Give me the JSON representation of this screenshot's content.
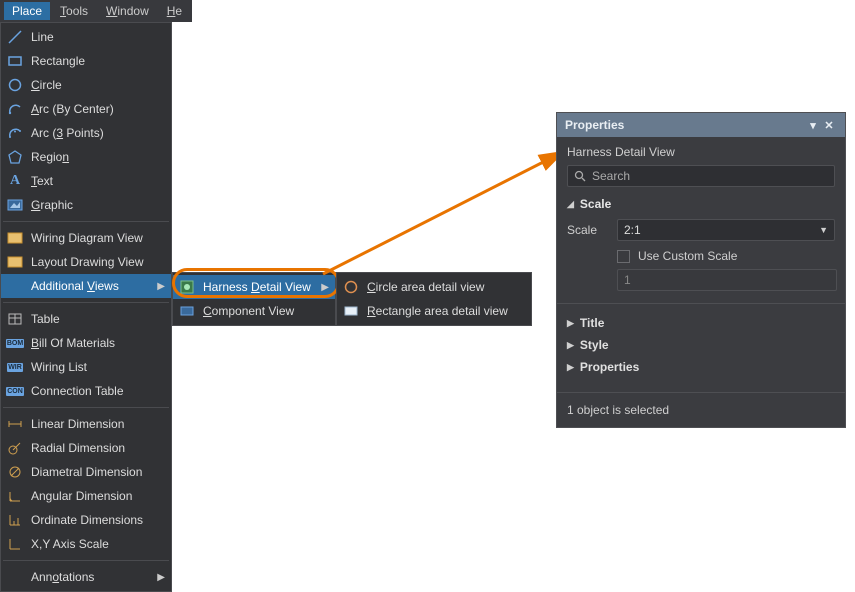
{
  "menubar": {
    "place": "Place",
    "tools": "Tools",
    "window": "Window",
    "help": "He"
  },
  "dropdown": {
    "line": "Line",
    "rectangle": "Rectangle",
    "circle": "Circle",
    "arc_center": "Arc (By Center)",
    "arc_3pts": "Arc (3 Points)",
    "region": "Region",
    "text": "Text",
    "graphic": "Graphic",
    "wiring_diagram_view": "Wiring Diagram View",
    "layout_drawing_view": "Layout Drawing View",
    "additional_views": "Additional Views",
    "table": "Table",
    "bom": "Bill Of Materials",
    "wiring_list": "Wiring List",
    "connection_table": "Connection Table",
    "linear_dim": "Linear Dimension",
    "radial_dim": "Radial Dimension",
    "diametral_dim": "Diametral Dimension",
    "angular_dim": "Angular Dimension",
    "ordinate_dims": "Ordinate Dimensions",
    "xy_axis_scale": "X,Y Axis Scale",
    "annotations": "Annotations"
  },
  "sub1": {
    "harness_detail_view": "Harness Detail View",
    "component_view": "Component View"
  },
  "sub2": {
    "circle_area": "Circle area detail view",
    "rect_area": "Rectangle area detail view"
  },
  "panel": {
    "title": "Properties",
    "context": "Harness Detail View",
    "search_placeholder": "Search",
    "section_scale": "Scale",
    "scale_label": "Scale",
    "scale_value": "2:1",
    "use_custom_scale": "Use Custom Scale",
    "custom_scale_value": "1",
    "section_title": "Title",
    "section_style": "Style",
    "section_properties": "Properties",
    "footer": "1 object is selected"
  }
}
